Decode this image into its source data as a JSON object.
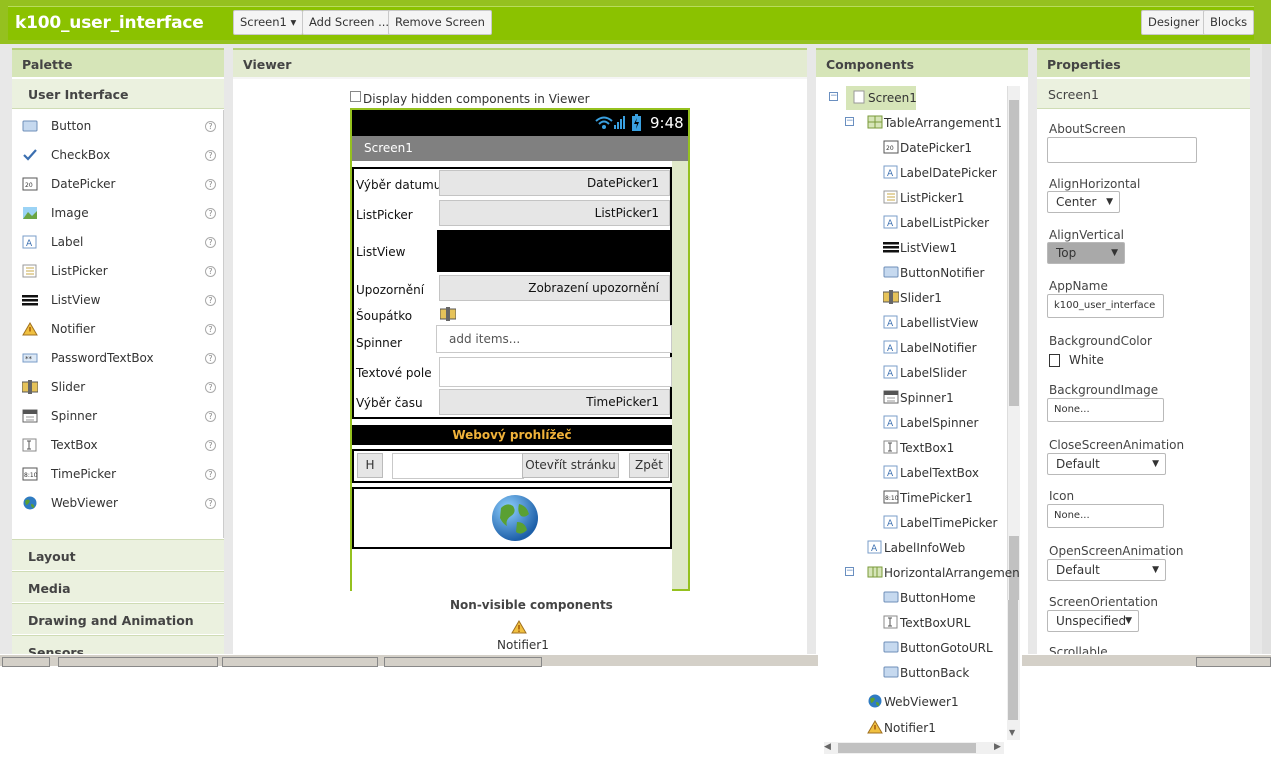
{
  "app": {
    "title": "k100_user_interface"
  },
  "toolbar": {
    "screen_select": "Screen1 ▾",
    "add_screen": "Add Screen ...",
    "remove_screen": "Remove Screen",
    "designer": "Designer",
    "blocks": "Blocks"
  },
  "palette": {
    "header": "Palette",
    "section": "User Interface",
    "items": [
      {
        "label": "Button",
        "icon": "button-icon"
      },
      {
        "label": "CheckBox",
        "icon": "checkbox-icon"
      },
      {
        "label": "DatePicker",
        "icon": "datepicker-icon"
      },
      {
        "label": "Image",
        "icon": "image-icon"
      },
      {
        "label": "Label",
        "icon": "label-icon"
      },
      {
        "label": "ListPicker",
        "icon": "listpicker-icon"
      },
      {
        "label": "ListView",
        "icon": "listview-icon"
      },
      {
        "label": "Notifier",
        "icon": "notifier-icon"
      },
      {
        "label": "PasswordTextBox",
        "icon": "password-icon"
      },
      {
        "label": "Slider",
        "icon": "slider-icon"
      },
      {
        "label": "Spinner",
        "icon": "spinner-icon"
      },
      {
        "label": "TextBox",
        "icon": "textbox-icon"
      },
      {
        "label": "TimePicker",
        "icon": "timepicker-icon"
      },
      {
        "label": "WebViewer",
        "icon": "webviewer-icon"
      }
    ],
    "help": "?",
    "categories": [
      "Layout",
      "Media",
      "Drawing and Animation",
      "Sensors"
    ]
  },
  "viewer": {
    "header": "Viewer",
    "hidden_checkbox_label": "Display hidden components in Viewer",
    "status_time": "9:48",
    "screen_title": "Screen1",
    "rows": {
      "date_label": "Výběr datumu",
      "date_button": "DatePicker1",
      "list_label": "ListPicker",
      "list_button": "ListPicker1",
      "listview_label": "ListView",
      "notifier_label": "Upozornění",
      "notifier_button": "Zobrazení upozornění",
      "slider_label": "Šoupátko",
      "spinner_label": "Spinner",
      "spinner_value": "add items...",
      "text_label": "Textové pole",
      "time_label": "Výběr času",
      "time_button": "TimePicker1"
    },
    "web_banner": "Webový prohlížeč",
    "home_button": "H",
    "goto_button": "Otevřít stránku",
    "back_button": "Zpět",
    "nonvisible_title": "Non-visible components",
    "nonvisible_item": "Notifier1"
  },
  "components": {
    "header": "Components",
    "tree": [
      {
        "label": "Screen1",
        "icon": "screen-icon"
      },
      {
        "label": "TableArrangement1",
        "icon": "table-icon"
      },
      {
        "label": "DatePicker1",
        "icon": "datepicker-icon"
      },
      {
        "label": "LabelDatePicker",
        "icon": "label-icon"
      },
      {
        "label": "ListPicker1",
        "icon": "listpicker-icon"
      },
      {
        "label": "LabelListPicker",
        "icon": "label-icon"
      },
      {
        "label": "ListView1",
        "icon": "listview-icon"
      },
      {
        "label": "ButtonNotifier",
        "icon": "button-icon"
      },
      {
        "label": "Slider1",
        "icon": "slider-icon"
      },
      {
        "label": "LabellistView",
        "icon": "label-icon"
      },
      {
        "label": "LabelNotifier",
        "icon": "label-icon"
      },
      {
        "label": "LabelSlider",
        "icon": "label-icon"
      },
      {
        "label": "Spinner1",
        "icon": "spinner-icon"
      },
      {
        "label": "LabelSpinner",
        "icon": "label-icon"
      },
      {
        "label": "TextBox1",
        "icon": "textbox-icon"
      },
      {
        "label": "LabelTextBox",
        "icon": "label-icon"
      },
      {
        "label": "TimePicker1",
        "icon": "timepicker-icon"
      },
      {
        "label": "LabelTimePicker",
        "icon": "label-icon"
      },
      {
        "label": "LabelInfoWeb",
        "icon": "label-icon"
      },
      {
        "label": "HorizontalArrangemen",
        "icon": "horizontal-icon"
      },
      {
        "label": "ButtonHome",
        "icon": "button-icon"
      },
      {
        "label": "TextBoxURL",
        "icon": "textbox-icon"
      },
      {
        "label": "ButtonGotoURL",
        "icon": "button-icon"
      },
      {
        "label": "ButtonBack",
        "icon": "button-icon"
      },
      {
        "label": "WebViewer1",
        "icon": "webviewer-icon"
      },
      {
        "label": "Notifier1",
        "icon": "notifier-icon"
      }
    ]
  },
  "properties": {
    "header": "Properties",
    "component": "Screen1",
    "about_label": "AboutScreen",
    "alignh_label": "AlignHorizontal",
    "alignh_value": "Center",
    "alignv_label": "AlignVertical",
    "alignv_value": "Top",
    "appname_label": "AppName",
    "appname_value": "k100_user_interface",
    "bgcolor_label": "BackgroundColor",
    "bgcolor_value": "White",
    "bgimage_label": "BackgroundImage",
    "bgimage_value": "None...",
    "close_anim_label": "CloseScreenAnimation",
    "close_anim_value": "Default",
    "icon_label": "Icon",
    "icon_value": "None...",
    "open_anim_label": "OpenScreenAnimation",
    "open_anim_value": "Default",
    "orientation_label": "ScreenOrientation",
    "orientation_value": "Unspecified",
    "scrollable_label": "Scrollable"
  },
  "colors": {
    "brand_green": "#8bc200",
    "panel_header": "#d6e5b8"
  }
}
